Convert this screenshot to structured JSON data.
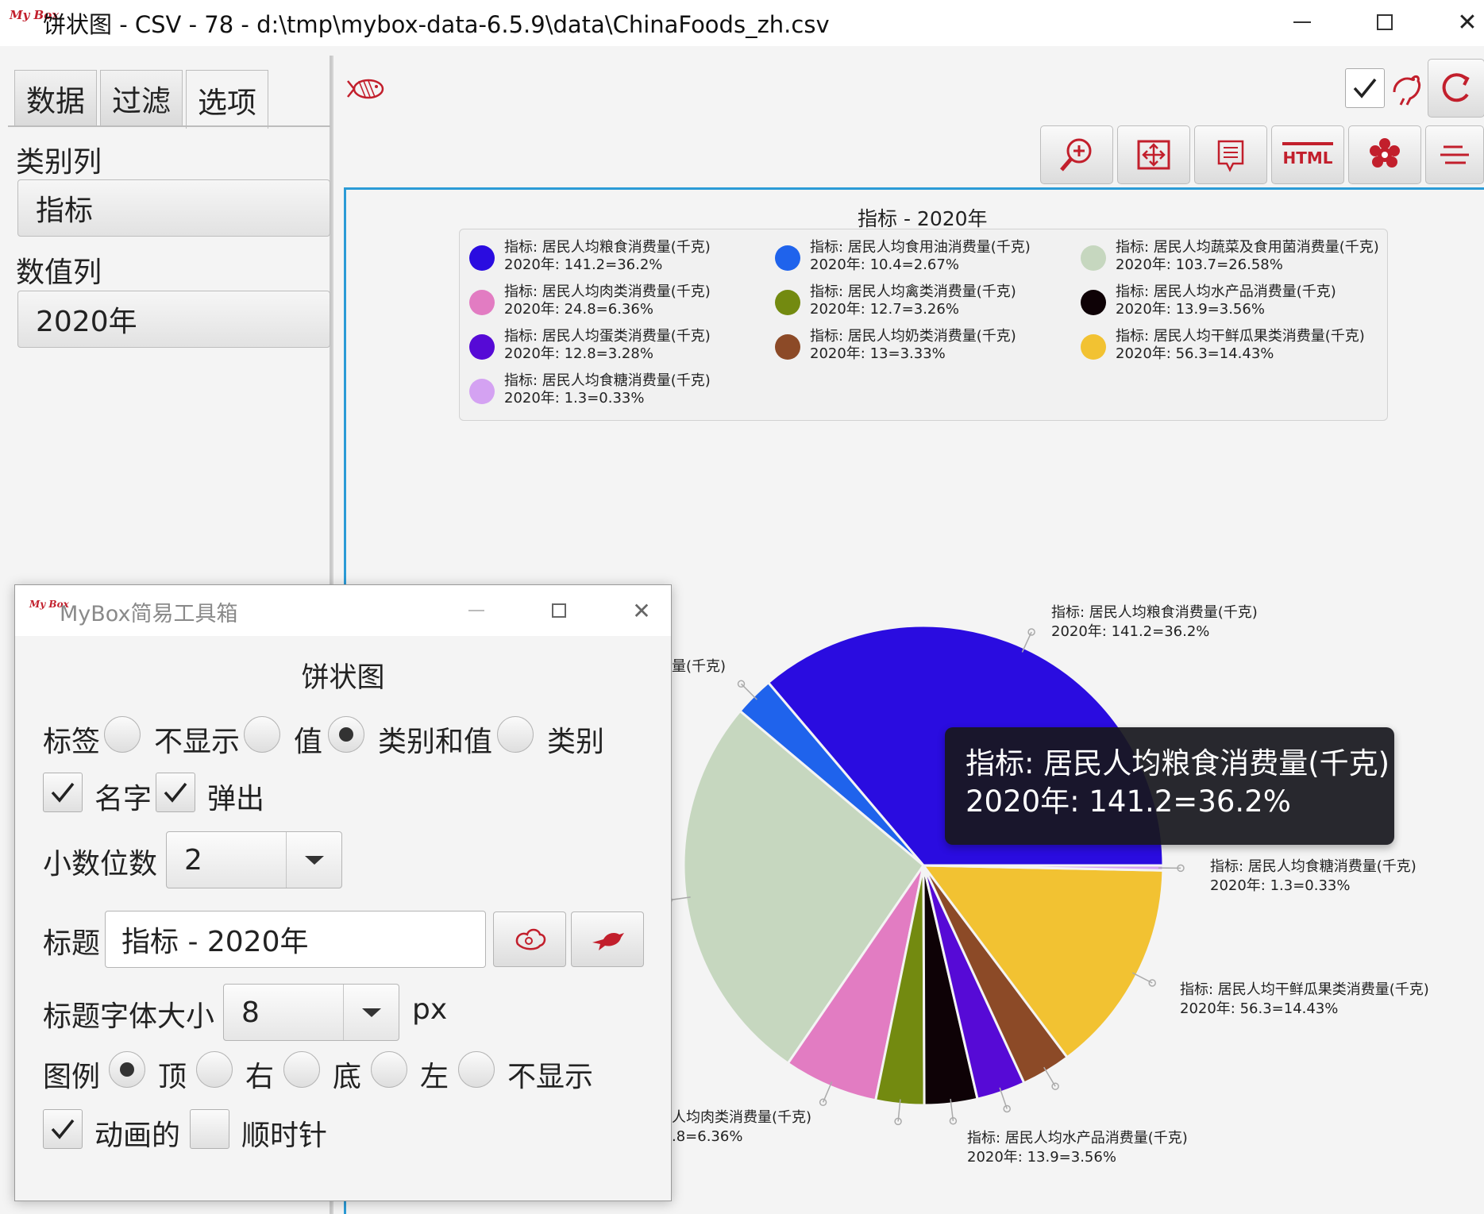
{
  "window": {
    "logo": "My Box",
    "title": "饼状图 - CSV - 78 - d:\\tmp\\mybox-data-6.5.9\\data\\ChinaFoods_zh.csv"
  },
  "left_panel": {
    "tabs": [
      {
        "label": "数据",
        "active": false
      },
      {
        "label": "过滤",
        "active": false
      },
      {
        "label": "选项",
        "active": true
      }
    ],
    "category_label": "类别列",
    "category_value": "指标",
    "value_label": "数值列",
    "value_value": "2020年"
  },
  "toolbar": {
    "icons": [
      "fish-icon",
      "check-icon",
      "rooster-icon",
      "refresh-icon",
      "zoom-in-icon",
      "fit-window-icon",
      "list-icon",
      "html-icon",
      "peony-icon",
      "menu-icon"
    ],
    "html_label": "HTML",
    "checked": true
  },
  "chart": {
    "title": "指标 - 2020年",
    "tooltip": {
      "line1": "指标: 居民人均粮食消费量(千克)",
      "line2": "2020年: 141.2=36.2%"
    },
    "outer_labels": [
      {
        "line1": "指标: 居民人均粮食消费量(千克)",
        "line2": "2020年: 141.2=36.2%"
      },
      {
        "line1": "量(千克)",
        "line2": ""
      },
      {
        "line1": "指标: 居民人均食糖消费量(千克)",
        "line2": "2020年: 1.3=0.33%"
      },
      {
        "line1": "指标: 居民人均干鲜瓜果类消费量(千克)",
        "line2": "2020年: 56.3=14.43%"
      },
      {
        "line1": "指标: 居民人均水产品消费量(千克)",
        "line2": "2020年: 13.9=3.56%"
      },
      {
        "line1": "人均肉类消费量(千克)",
        "line2": ".8=6.36%"
      }
    ]
  },
  "chart_data": {
    "type": "pie",
    "title": "指标 - 2020年",
    "legend_position": "top",
    "clockwise": false,
    "series": [
      {
        "name": "指标: 居民人均粮食消费量(千克)",
        "value": 141.2,
        "percent": "36.2%",
        "label": "2020年: 141.2=36.2%",
        "color": "#2a0ce0"
      },
      {
        "name": "指标: 居民人均食用油消费量(千克)",
        "value": 10.4,
        "percent": "2.67%",
        "label": "2020年: 10.4=2.67%",
        "color": "#1f63ec"
      },
      {
        "name": "指标: 居民人均蔬菜及食用菌消费量(千克)",
        "value": 103.7,
        "percent": "26.58%",
        "label": "2020年: 103.7=26.58%",
        "color": "#c6d7bf"
      },
      {
        "name": "指标: 居民人均肉类消费量(千克)",
        "value": 24.8,
        "percent": "6.36%",
        "label": "2020年: 24.8=6.36%",
        "color": "#e27cc2"
      },
      {
        "name": "指标: 居民人均禽类消费量(千克)",
        "value": 12.7,
        "percent": "3.26%",
        "label": "2020年: 12.7=3.26%",
        "color": "#738a10"
      },
      {
        "name": "指标: 居民人均水产品消费量(千克)",
        "value": 13.9,
        "percent": "3.56%",
        "label": "2020年: 13.9=3.56%",
        "color": "#0e0206"
      },
      {
        "name": "指标: 居民人均蛋类消费量(千克)",
        "value": 12.8,
        "percent": "3.28%",
        "label": "2020年: 12.8=3.28%",
        "color": "#560ad6"
      },
      {
        "name": "指标: 居民人均奶类消费量(千克)",
        "value": 13,
        "percent": "3.33%",
        "label": "2020年: 13=3.33%",
        "color": "#8c4a27"
      },
      {
        "name": "指标: 居民人均干鲜瓜果类消费量(千克)",
        "value": 56.3,
        "percent": "14.43%",
        "label": "2020年: 56.3=14.43%",
        "color": "#f2c232"
      },
      {
        "name": "指标: 居民人均食糖消费量(千克)",
        "value": 1.3,
        "percent": "0.33%",
        "label": "2020年: 1.3=0.33%",
        "color": "#d4a2f2"
      }
    ]
  },
  "tool_window": {
    "logo": "My Box",
    "title": "MyBox简易工具箱",
    "heading": "饼状图",
    "label_row": {
      "label": "标签",
      "options": [
        {
          "text": "不显示",
          "selected": false
        },
        {
          "text": "值",
          "selected": false
        },
        {
          "text": "类别和值",
          "selected": true
        },
        {
          "text": "类别",
          "selected": false
        }
      ]
    },
    "name_checkbox": {
      "text": "名字",
      "checked": true
    },
    "popup_checkbox": {
      "text": "弹出",
      "checked": true
    },
    "decimal_label": "小数位数",
    "decimal_value": "2",
    "title_label": "标题",
    "title_value": "指标 - 2020年",
    "font_label": "标题字体大小",
    "font_value": "8",
    "font_unit": "px",
    "legend_row": {
      "label": "图例",
      "options": [
        {
          "text": "顶",
          "selected": true
        },
        {
          "text": "右",
          "selected": false
        },
        {
          "text": "底",
          "selected": false
        },
        {
          "text": "左",
          "selected": false
        },
        {
          "text": "不显示",
          "selected": false
        }
      ]
    },
    "animated_checkbox": {
      "text": "动画的",
      "checked": true
    },
    "clockwise_checkbox": {
      "text": "顺时针",
      "checked": false
    }
  }
}
